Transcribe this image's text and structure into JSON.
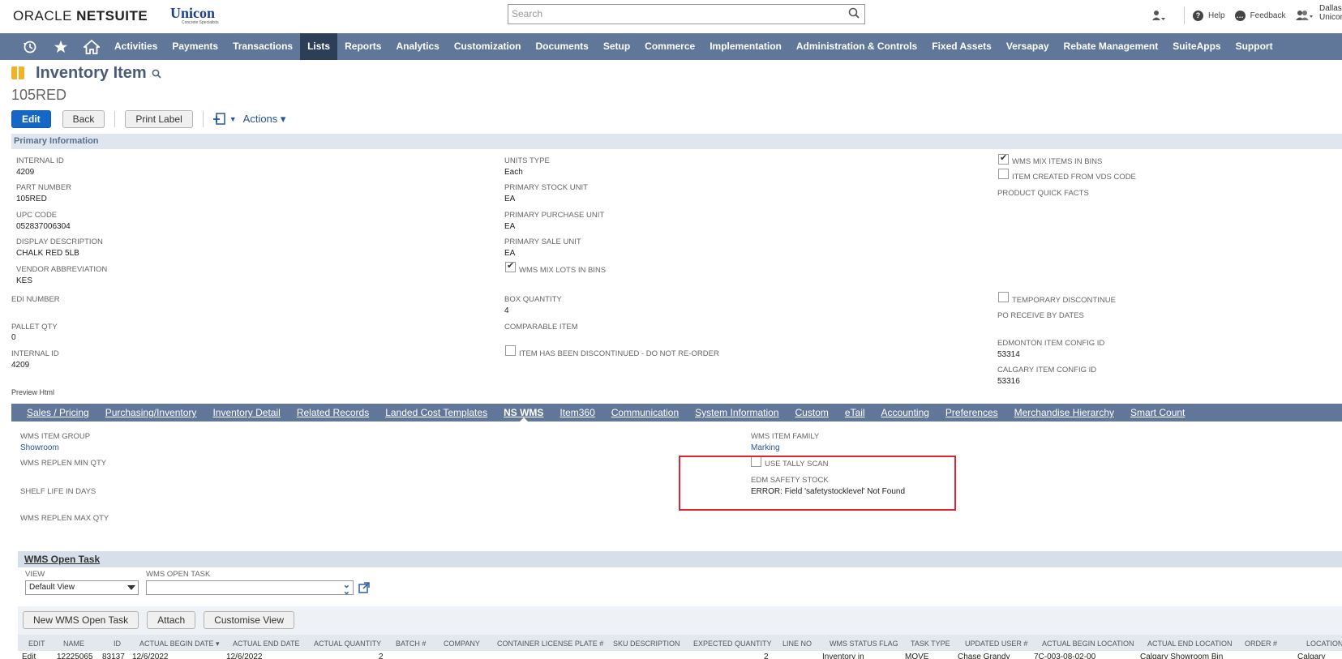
{
  "header": {
    "brand_oracle": "ORACLE",
    "brand_netsuite": "NETSUITE",
    "company_logo": "Unicon",
    "company_tagline": "Concrete Specialists",
    "search_placeholder": "Search",
    "help_label": "Help",
    "feedback_label": "Feedback",
    "user_line1": "Dallas",
    "user_line2": "Unicon"
  },
  "nav": {
    "items": [
      "Activities",
      "Payments",
      "Transactions",
      "Lists",
      "Reports",
      "Analytics",
      "Customization",
      "Documents",
      "Setup",
      "Commerce",
      "Implementation",
      "Administration & Controls",
      "Fixed Assets",
      "Versapay",
      "Rebate Management",
      "SuiteApps",
      "Support"
    ],
    "active": "Lists",
    "icons": [
      "recent-icon",
      "star-icon",
      "home-icon"
    ]
  },
  "record": {
    "type_title": "Inventory Item",
    "name": "105RED"
  },
  "buttons": {
    "edit": "Edit",
    "back": "Back",
    "print_label": "Print Label",
    "actions": "Actions ▾"
  },
  "primary": {
    "section_title": "Primary Information",
    "col1": {
      "internal_id_label": "INTERNAL ID",
      "internal_id": "4209",
      "part_number_label": "PART NUMBER",
      "part_number": "105RED",
      "upc_label": "UPC CODE",
      "upc": "052837006304",
      "display_desc_label": "DISPLAY DESCRIPTION",
      "display_desc": "CHALK RED 5LB",
      "vendor_abbr_label": "VENDOR ABBREVIATION",
      "vendor_abbr": "KES",
      "edi_label": "EDI NUMBER",
      "pallet_label": "PALLET QTY",
      "pallet": "0",
      "internal_id2_label": "INTERNAL ID",
      "internal_id2": "4209"
    },
    "col2": {
      "units_type_label": "UNITS TYPE",
      "units_type": "Each",
      "primary_stock_label": "PRIMARY STOCK UNIT",
      "primary_stock": "EA",
      "primary_purchase_label": "PRIMARY PURCHASE UNIT",
      "primary_purchase": "EA",
      "primary_sale_label": "PRIMARY SALE UNIT",
      "primary_sale": "EA",
      "wms_mix_lots_label": "WMS MIX LOTS IN BINS",
      "box_qty_label": "BOX QUANTITY",
      "box_qty": "4",
      "comparable_label": "COMPARABLE ITEM",
      "discontinued_label": "ITEM HAS BEEN DISCONTINUED - DO NOT RE-ORDER"
    },
    "col3": {
      "wms_mix_items_label": "WMS MIX ITEMS IN BINS",
      "created_vds_label": "ITEM CREATED FROM VDS CODE",
      "quick_facts_label": "PRODUCT QUICK FACTS",
      "temp_disc_label": "TEMPORARY DISCONTINUE",
      "po_receive_label": "PO RECEIVE BY DATES",
      "edmonton_label": "EDMONTON ITEM CONFIG ID",
      "edmonton": "53314",
      "calgary_label": "CALGARY ITEM CONFIG ID",
      "calgary": "53316"
    },
    "preview_html": "Preview Html"
  },
  "subtabs": {
    "items": [
      "Sales / Pricing",
      "Purchasing/Inventory",
      "Inventory Detail",
      "Related Records",
      "Landed Cost Templates",
      "NS WMS",
      "Item360",
      "Communication",
      "System Information",
      "Custom",
      "eTail",
      "Accounting",
      "Preferences",
      "Merchandise Hierarchy",
      "Smart Count"
    ],
    "active": "NS WMS"
  },
  "nswms": {
    "item_group_label": "WMS ITEM GROUP",
    "item_group": "Showroom",
    "replen_min_label": "WMS REPLEN MIN QTY",
    "shelf_life_label": "SHELF LIFE IN DAYS",
    "replen_max_label": "WMS REPLEN MAX QTY",
    "item_family_label": "WMS ITEM FAMILY",
    "item_family": "Marking",
    "tally_label": "USE TALLY SCAN",
    "edm_safety_label": "EDM SAFETY STOCK",
    "edm_safety_error": "ERROR: Field 'safetystocklevel' Not Found"
  },
  "wms_open_task": {
    "title": "WMS Open Task",
    "view_label": "VIEW",
    "view_value": "Default View",
    "open_task_label": "WMS OPEN TASK",
    "open_task_value": "",
    "btn_new": "New WMS Open Task",
    "btn_attach": "Attach",
    "btn_customise": "Customise View",
    "columns": [
      "EDIT",
      "NAME",
      "ID",
      "ACTUAL BEGIN DATE ▾",
      "ACTUAL END DATE",
      "ACTUAL QUANTITY",
      "BATCH #",
      "COMPANY",
      "CONTAINER LICENSE PLATE #",
      "SKU DESCRIPTION",
      "EXPECTED QUANTITY",
      "LINE NO",
      "WMS STATUS FLAG",
      "TASK TYPE",
      "UPDATED USER #",
      "ACTUAL BEGIN LOCATION",
      "ACTUAL END LOCATION",
      "ORDER #",
      "LOCATION"
    ],
    "row": {
      "edit": "Edit",
      "name": "12225065",
      "id": "83137",
      "begin": "12/6/2022",
      "end": "12/6/2022",
      "qty": "2",
      "expected": "2",
      "status": "Inventory in",
      "task": "MOVE",
      "user": "Chase Grandy",
      "begin_loc": "7C-003-08-02-00",
      "end_loc": "Calgary Showroom Bin",
      "location": "Calgary"
    }
  }
}
